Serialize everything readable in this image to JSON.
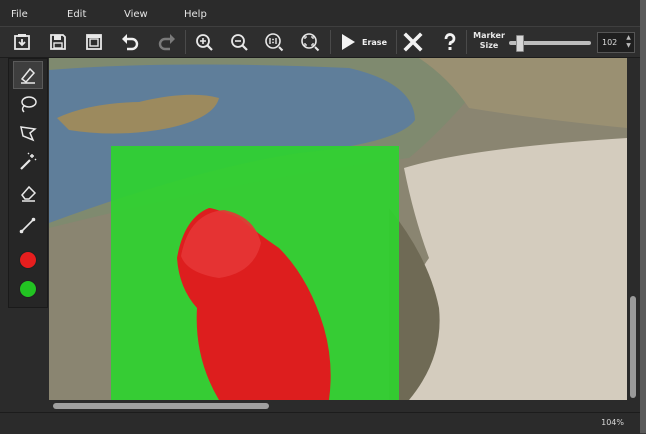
{
  "menu": {
    "file": "File",
    "edit": "Edit",
    "view": "View",
    "help": "Help"
  },
  "toolbar": {
    "erase_label": "Erase",
    "marker_size_line1": "Marker",
    "marker_size_line2": "Size",
    "marker_size_value": "102",
    "marker_size_fraction": 0.12,
    "spin_up": "▲",
    "spin_down": "▼",
    "icons": [
      "import-icon",
      "save-icon",
      "export-icon",
      "undo-icon",
      "redo-icon",
      "zoom-in-icon",
      "zoom-out-icon",
      "actual-size-icon",
      "fit-screen-icon",
      "play-icon",
      "close-icon",
      "help-icon"
    ]
  },
  "tools": {
    "icons": [
      "marker-icon",
      "lasso-icon",
      "polygon-lasso-icon",
      "magic-wand-icon",
      "eraser-icon",
      "line-icon"
    ],
    "colors": {
      "foreground": "#e61e1e",
      "background": "#22c322"
    }
  },
  "canvas": {
    "overlays": {
      "keep_color": "#2fd22f",
      "remove_color": "#dd1e1e"
    }
  },
  "status": {
    "zoom": "104%"
  },
  "colors": {
    "window_bg": "#2b2b2b",
    "toolbar_bg": "#2e2e2e",
    "accent_green": "#22c322",
    "accent_red": "#e61e1e"
  }
}
